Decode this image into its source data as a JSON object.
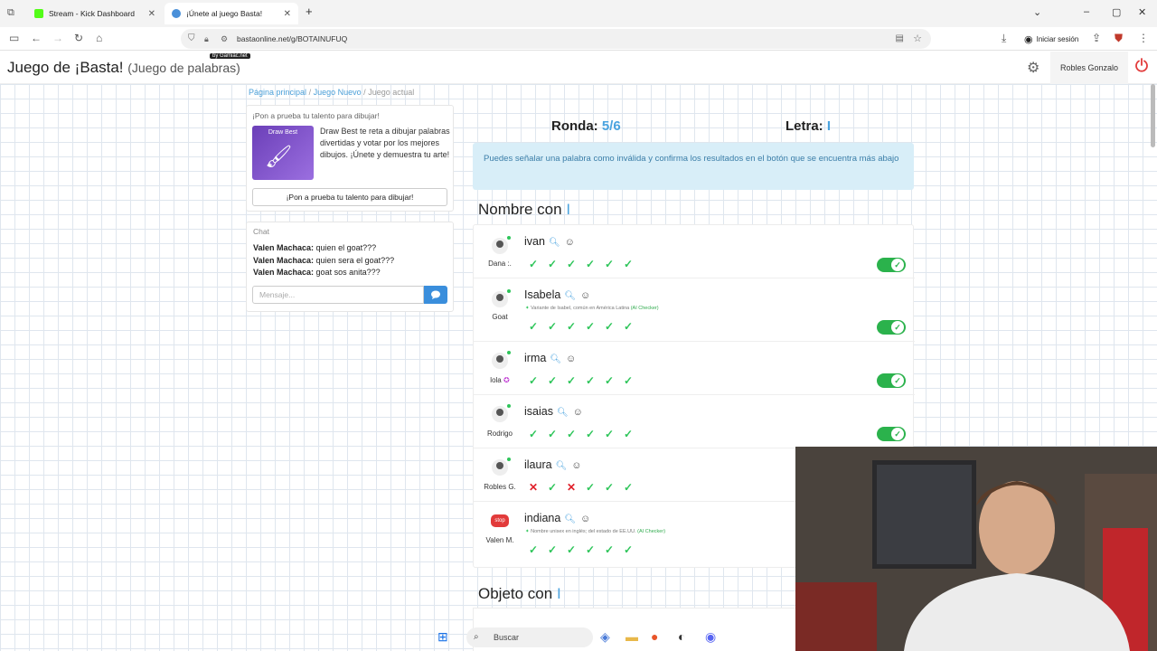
{
  "browser": {
    "tabs": [
      {
        "title": "Stream - Kick Dashboard",
        "active": false,
        "favicon_color": "#53fc18"
      },
      {
        "title": "¡Únete al juego Basta!",
        "active": true,
        "favicon_color": "#4a90d9"
      }
    ],
    "url": "bastaonline.net/g/BOTAINUFUQ",
    "signin_label": "Iniciar sesión"
  },
  "site": {
    "title": "Juego de ¡Basta!",
    "subtitle": "(Juego de palabras)",
    "badge": "by Gamiac.net",
    "user": "Robles Gonzalo"
  },
  "breadcrumb": {
    "home": "Página principal",
    "new": "Juego Nuevo",
    "current": "Juego actual",
    "sep": "/"
  },
  "promo": {
    "title": "¡Pon a prueba tu talento para dibujar!",
    "image_label": "Draw Best",
    "text": "Draw Best te reta a dibujar palabras divertidas y votar por los mejores dibujos. ¡Únete y demuestra tu arte!",
    "button": "¡Pon a prueba tu talento para dibujar!"
  },
  "chat": {
    "title": "Chat",
    "messages": [
      {
        "user": "Valen Machaca:",
        "text": " quien el goat???"
      },
      {
        "user": "Valen Machaca:",
        "text": " quien sera el goat???"
      },
      {
        "user": "Valen Machaca:",
        "text": " goat sos anita???"
      }
    ],
    "placeholder": "Mensaje..."
  },
  "game": {
    "round_label": "Ronda:",
    "round_value": "5/6",
    "letter_label": "Letra:",
    "letter_value": "I",
    "info": "Puedes señalar una palabra como inválida y confirma los resultados en el botón que se encuentra más abajo"
  },
  "categories": [
    {
      "label": "Nombre con",
      "letter": "I"
    },
    {
      "label": "Objeto con",
      "letter": "I"
    }
  ],
  "answers": [
    {
      "word": "ivan",
      "player": "Dana :.",
      "note": "",
      "marks": [
        "ok",
        "ok",
        "ok",
        "ok",
        "ok",
        "ok"
      ],
      "valid": true
    },
    {
      "word": "Isabela",
      "player": "Goat",
      "note": "Variante de Isabel, común en América Latina",
      "note_tag": "(AI Checker)",
      "marks": [
        "ok",
        "ok",
        "ok",
        "ok",
        "ok",
        "ok"
      ],
      "valid": true
    },
    {
      "word": "irma",
      "player": "lola",
      "note": "",
      "marks": [
        "ok",
        "ok",
        "ok",
        "ok",
        "ok",
        "ok"
      ],
      "valid": true
    },
    {
      "word": "isaias",
      "player": "Rodrigo",
      "note": "",
      "marks": [
        "ok",
        "ok",
        "ok",
        "ok",
        "ok",
        "ok"
      ],
      "valid": true
    },
    {
      "word": "ilaura",
      "player": "Robles G.",
      "note": "",
      "marks": [
        "bad",
        "ok",
        "bad",
        "ok",
        "ok",
        "ok"
      ],
      "valid": null
    },
    {
      "word": "indiana",
      "player": "Valen M.",
      "note": "Nombre unisex en inglés; del estado de EE.UU.",
      "note_tag": "(AI Checker)",
      "marks": [
        "ok",
        "ok",
        "ok",
        "ok",
        "ok",
        "ok"
      ],
      "valid": null
    }
  ],
  "taskbar": {
    "search": "Buscar"
  },
  "colors": {
    "accent": "#4aa3df",
    "ok": "#2ec55a",
    "bad": "#e0202a",
    "toggle": "#2bb24c",
    "info_bg": "#d8eef8"
  }
}
